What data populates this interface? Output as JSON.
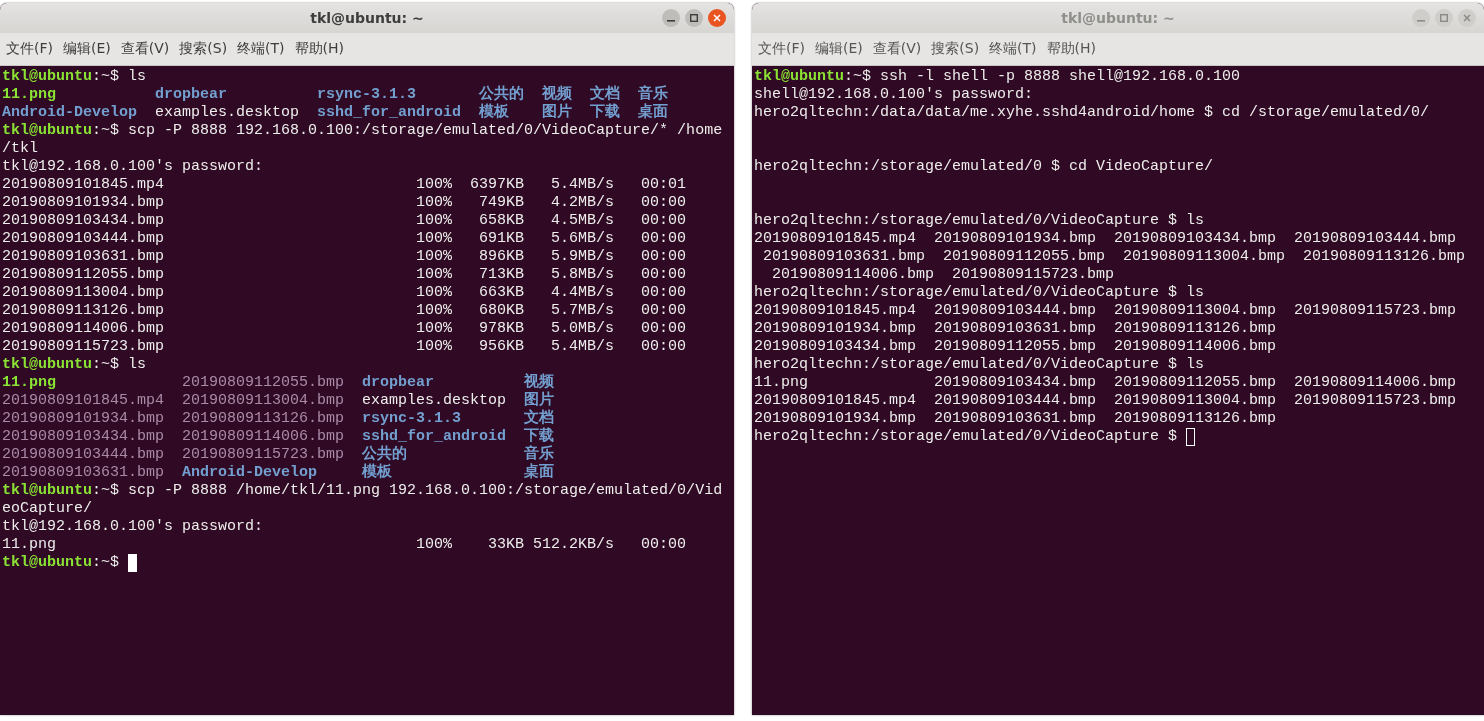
{
  "windows": [
    {
      "title": "tkl@ubuntu: ~",
      "active": true,
      "menu": [
        "文件(F)",
        "编辑(E)",
        "查看(V)",
        "搜索(S)",
        "终端(T)",
        "帮助(H)"
      ],
      "lines": [
        {
          "kind": "prompt",
          "user": "tkl@ubuntu",
          "sign": ":~$",
          "command": "ls"
        },
        {
          "kind": "listing",
          "rows": [
            [
              {
                "text": "11.png",
                "kind": "exec"
              },
              {
                "text": "dropbear",
                "kind": "dir"
              },
              {
                "text": "rsync-3.1.3",
                "kind": "dir"
              },
              {
                "text": "公共的",
                "kind": "dir"
              },
              {
                "text": "视频",
                "kind": "dir"
              },
              {
                "text": "文档",
                "kind": "dir"
              },
              {
                "text": "音乐",
                "kind": "dir"
              }
            ],
            [
              {
                "text": "Android-Develop",
                "kind": "dir"
              },
              {
                "text": "examples.desktop",
                "kind": "file"
              },
              {
                "text": "sshd_for_android",
                "kind": "dir"
              },
              {
                "text": "模板",
                "kind": "dir"
              },
              {
                "text": "图片",
                "kind": "dir"
              },
              {
                "text": "下载",
                "kind": "dir"
              },
              {
                "text": "桌面",
                "kind": "dir"
              }
            ]
          ]
        },
        {
          "kind": "prompt",
          "user": "tkl@ubuntu",
          "sign": ":~$",
          "command": "scp -P 8888 192.168.0.100:/storage/emulated/0/VideoCapture/* /home"
        },
        {
          "kind": "text",
          "text": "/tkl"
        },
        {
          "kind": "text",
          "text": "tkl@192.168.0.100's password:"
        },
        {
          "kind": "progress",
          "file": "20190809101845.mp4",
          "percent": "100%",
          "size": "6397KB",
          "rate": "5.4MB/s",
          "time": "00:01"
        },
        {
          "kind": "progress",
          "file": "20190809101934.bmp",
          "percent": "100%",
          "size": "749KB",
          "rate": "4.2MB/s",
          "time": "00:00"
        },
        {
          "kind": "progress",
          "file": "20190809103434.bmp",
          "percent": "100%",
          "size": "658KB",
          "rate": "4.5MB/s",
          "time": "00:00"
        },
        {
          "kind": "progress",
          "file": "20190809103444.bmp",
          "percent": "100%",
          "size": "691KB",
          "rate": "5.6MB/s",
          "time": "00:00"
        },
        {
          "kind": "progress",
          "file": "20190809103631.bmp",
          "percent": "100%",
          "size": "896KB",
          "rate": "5.9MB/s",
          "time": "00:00"
        },
        {
          "kind": "progress",
          "file": "20190809112055.bmp",
          "percent": "100%",
          "size": "713KB",
          "rate": "5.8MB/s",
          "time": "00:00"
        },
        {
          "kind": "progress",
          "file": "20190809113004.bmp",
          "percent": "100%",
          "size": "663KB",
          "rate": "4.4MB/s",
          "time": "00:00"
        },
        {
          "kind": "progress",
          "file": "20190809113126.bmp",
          "percent": "100%",
          "size": "680KB",
          "rate": "5.7MB/s",
          "time": "00:00"
        },
        {
          "kind": "progress",
          "file": "20190809114006.bmp",
          "percent": "100%",
          "size": "978KB",
          "rate": "5.0MB/s",
          "time": "00:00"
        },
        {
          "kind": "progress",
          "file": "20190809115723.bmp",
          "percent": "100%",
          "size": "956KB",
          "rate": "5.4MB/s",
          "time": "00:00"
        },
        {
          "kind": "prompt",
          "user": "tkl@ubuntu",
          "sign": ":~$",
          "command": "ls"
        },
        {
          "kind": "listing",
          "rows": [
            [
              {
                "text": "11.png",
                "kind": "exec"
              },
              {
                "text": "20190809112055.bmp",
                "kind": "media"
              },
              {
                "text": "dropbear",
                "kind": "dir"
              },
              {
                "text": "视频",
                "kind": "dir"
              }
            ],
            [
              {
                "text": "20190809101845.mp4",
                "kind": "media"
              },
              {
                "text": "20190809113004.bmp",
                "kind": "media"
              },
              {
                "text": "examples.desktop",
                "kind": "file"
              },
              {
                "text": "图片",
                "kind": "dir"
              }
            ],
            [
              {
                "text": "20190809101934.bmp",
                "kind": "media"
              },
              {
                "text": "20190809113126.bmp",
                "kind": "media"
              },
              {
                "text": "rsync-3.1.3",
                "kind": "dir"
              },
              {
                "text": "文档",
                "kind": "dir"
              }
            ],
            [
              {
                "text": "20190809103434.bmp",
                "kind": "media"
              },
              {
                "text": "20190809114006.bmp",
                "kind": "media"
              },
              {
                "text": "sshd_for_android",
                "kind": "dir"
              },
              {
                "text": "下载",
                "kind": "dir"
              }
            ],
            [
              {
                "text": "20190809103444.bmp",
                "kind": "media"
              },
              {
                "text": "20190809115723.bmp",
                "kind": "media"
              },
              {
                "text": "公共的",
                "kind": "dir"
              },
              {
                "text": "音乐",
                "kind": "dir"
              }
            ],
            [
              {
                "text": "20190809103631.bmp",
                "kind": "media"
              },
              {
                "text": "Android-Develop",
                "kind": "dir"
              },
              {
                "text": "模板",
                "kind": "dir"
              },
              {
                "text": "桌面",
                "kind": "dir"
              }
            ]
          ]
        },
        {
          "kind": "prompt",
          "user": "tkl@ubuntu",
          "sign": ":~$",
          "command": "scp -P 8888 /home/tkl/11.png 192.168.0.100:/storage/emulated/0/Vid"
        },
        {
          "kind": "text",
          "text": "eoCapture/"
        },
        {
          "kind": "text",
          "text": "tkl@192.168.0.100's password:"
        },
        {
          "kind": "progress",
          "file": "11.png",
          "percent": "100%",
          "size": "33KB",
          "rate": "512.2KB/s",
          "time": "00:00"
        },
        {
          "kind": "prompt",
          "user": "tkl@ubuntu",
          "sign": ":~$",
          "cursor": true
        }
      ]
    },
    {
      "title": "tkl@ubuntu: ~",
      "active": false,
      "menu": [
        "文件(F)",
        "编辑(E)",
        "查看(V)",
        "搜索(S)",
        "终端(T)",
        "帮助(H)"
      ],
      "lines": [
        {
          "kind": "prompt",
          "user": "tkl@ubuntu",
          "sign": ":~$",
          "command": "ssh -l shell -p 8888 shell@192.168.0.100"
        },
        {
          "kind": "text",
          "text": "shell@192.168.0.100's password:"
        },
        {
          "kind": "text",
          "text": "hero2qltechn:/data/data/me.xyhe.sshd4android/home $ cd /storage/emulated/0/"
        },
        {
          "kind": "blank"
        },
        {
          "kind": "blank"
        },
        {
          "kind": "text",
          "text": "hero2qltechn:/storage/emulated/0 $ cd VideoCapture/"
        },
        {
          "kind": "blank"
        },
        {
          "kind": "blank"
        },
        {
          "kind": "text",
          "text": "hero2qltechn:/storage/emulated/0/VideoCapture $ ls"
        },
        {
          "kind": "text",
          "text": "20190809101845.mp4  20190809101934.bmp  20190809103434.bmp  20190809103444.bmp"
        },
        {
          "kind": "text",
          "text": " 20190809103631.bmp  20190809112055.bmp  20190809113004.bmp  20190809113126.bmp"
        },
        {
          "kind": "text",
          "text": "  20190809114006.bmp  20190809115723.bmp"
        },
        {
          "kind": "text",
          "text": "hero2qltechn:/storage/emulated/0/VideoCapture $ ls"
        },
        {
          "kind": "text",
          "text": "20190809101845.mp4  20190809103444.bmp  20190809113004.bmp  20190809115723.bmp"
        },
        {
          "kind": "text",
          "text": "20190809101934.bmp  20190809103631.bmp  20190809113126.bmp"
        },
        {
          "kind": "text",
          "text": "20190809103434.bmp  20190809112055.bmp  20190809114006.bmp"
        },
        {
          "kind": "text",
          "text": "hero2qltechn:/storage/emulated/0/VideoCapture $ ls"
        },
        {
          "kind": "text",
          "text": "11.png              20190809103434.bmp  20190809112055.bmp  20190809114006.bmp"
        },
        {
          "kind": "text",
          "text": "20190809101845.mp4  20190809103444.bmp  20190809113004.bmp  20190809115723.bmp"
        },
        {
          "kind": "text",
          "text": "20190809101934.bmp  20190809103631.bmp  20190809113126.bmp"
        },
        {
          "kind": "text",
          "text": "hero2qltechn:/storage/emulated/0/VideoCapture $",
          "cursor": true
        }
      ]
    }
  ]
}
